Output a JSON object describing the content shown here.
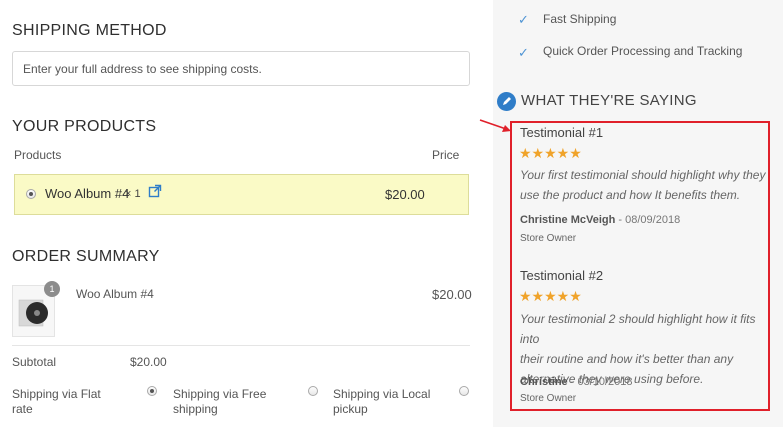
{
  "shipping_method": {
    "heading": "SHIPPING METHOD",
    "address_placeholder": "Enter your full address to see shipping costs."
  },
  "products": {
    "heading": "YOUR PRODUCTS",
    "col_products": "Products",
    "col_price": "Price",
    "item": {
      "name": "Woo Album #4",
      "qty_text": "× 1",
      "price": "$20.00"
    }
  },
  "order_summary": {
    "heading": "ORDER SUMMARY",
    "item": {
      "name": "Woo Album #4",
      "price": "$20.00",
      "qty_badge": "1"
    },
    "subtotal_label": "Subtotal",
    "subtotal_value": "$20.00",
    "shipping_options": [
      {
        "label_line1": "Shipping via Flat",
        "label_line2": "rate",
        "selected": true
      },
      {
        "label_line1": "Shipping via Free",
        "label_line2": "shipping",
        "selected": false
      },
      {
        "label_line1": "Shipping via Local",
        "label_line2": "pickup",
        "selected": false
      }
    ]
  },
  "features": [
    {
      "label": "Fast Shipping",
      "icon": "check-icon"
    },
    {
      "label": "Quick Order Processing and Tracking",
      "icon": "check-icon"
    }
  ],
  "testimonials_section": {
    "heading": "WHAT THEY'RE SAYING",
    "icon": "pencil-icon",
    "items": [
      {
        "title": "Testimonial #1",
        "stars": "★★★★★",
        "rating": 5,
        "text_lines": [
          "Your first testimonial should highlight why they",
          "use the product and how It benefits them."
        ],
        "author": "Christine McVeigh",
        "date": " - 08/09/2018",
        "role": "Store Owner"
      },
      {
        "title": "Testimonial #2",
        "stars": "★★★★★",
        "rating": 5,
        "text_lines": [
          "Your testimonial 2 should highlight how it fits into",
          "their routine and how it's better than any",
          "alternative they were using before."
        ],
        "author": "Christine",
        "date": " - 03/10/2018",
        "role": "Store Owner"
      }
    ]
  },
  "colors": {
    "accent_blue": "#2f7dc8",
    "highlight_border": "#e0202a",
    "star": "#f0a32a",
    "product_row_bg": "#fafac6"
  }
}
